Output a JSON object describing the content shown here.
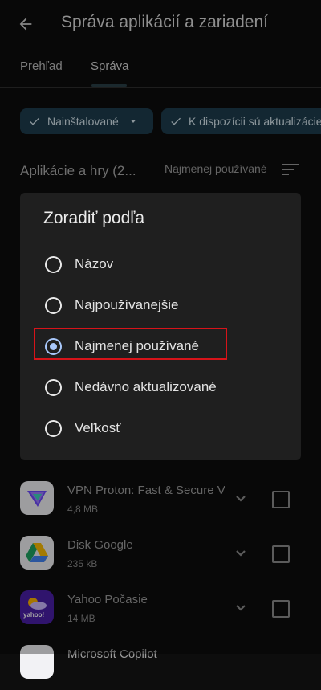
{
  "header": {
    "title": "Správa aplikácií a zariadení",
    "back_icon": "arrow-back-icon"
  },
  "tabs": [
    {
      "label": "Prehľad"
    },
    {
      "label": "Správa"
    }
  ],
  "filters": {
    "installed": {
      "label": "Nainštalované"
    },
    "updates": {
      "label": "K dispozícii sú aktualizácie"
    }
  },
  "section": {
    "title": "Aplikácie a hry (2...",
    "sort_label": "Najmenej používané"
  },
  "dialog": {
    "title": "Zoradiť podľa",
    "options": [
      {
        "label": "Názov",
        "selected": false
      },
      {
        "label": "Najpoužívanejšie",
        "selected": false
      },
      {
        "label": "Najmenej používané",
        "selected": true
      },
      {
        "label": "Nedávno aktualizované",
        "selected": false
      },
      {
        "label": "Veľkosť",
        "selected": false
      }
    ]
  },
  "apps": [
    {
      "name": "VPN Proton: Fast & Secure VPN",
      "size": "4,8 MB"
    },
    {
      "name": "Disk Google",
      "size": "235 kB"
    },
    {
      "name": "Yahoo Počasie",
      "size": "14 MB",
      "icon_text": "yahoo!"
    },
    {
      "name": "Microsoft Copilot",
      "size": ""
    }
  ],
  "colors": {
    "accent": "#a8c7fa",
    "chip_bg": "#1e3d4d",
    "highlight": "#d7141a",
    "dialog_bg": "#1f1f1f"
  }
}
